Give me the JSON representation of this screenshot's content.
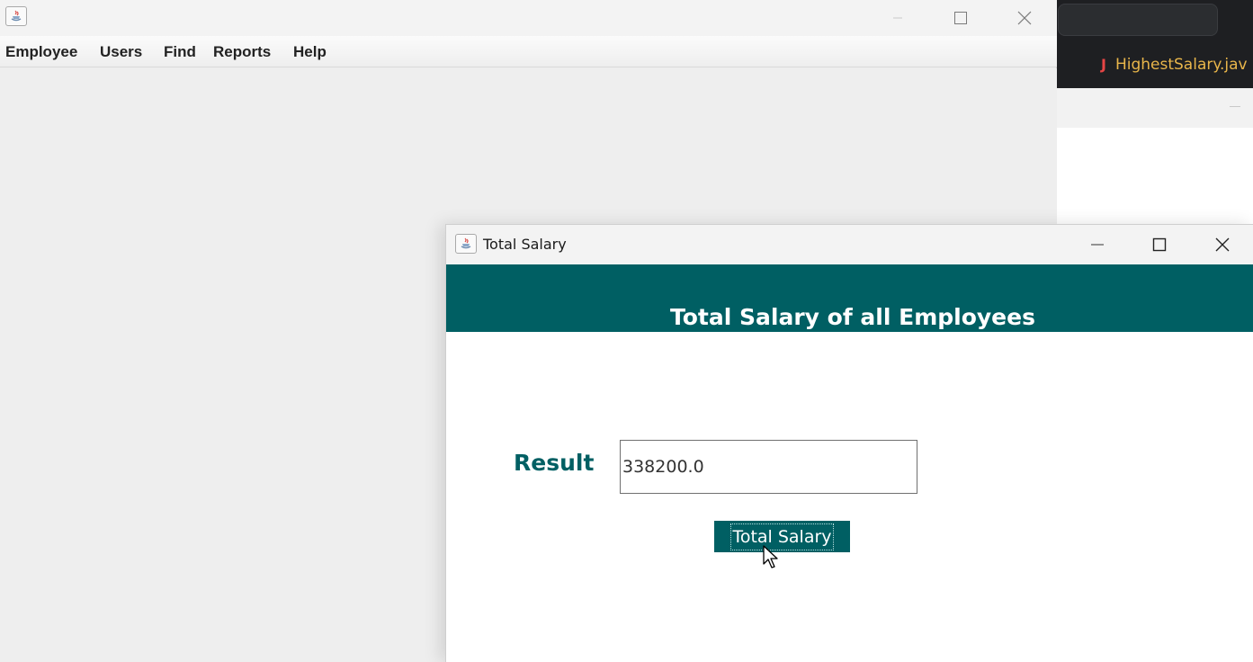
{
  "ide": {
    "tab_label": "HighestSalary.jav",
    "tab_icon": "java-file-icon"
  },
  "main_window": {
    "icon": "java-app-icon",
    "menu": [
      "Employee",
      "Users",
      "Find",
      "Reports",
      "Help"
    ]
  },
  "dialog": {
    "title": "Total Salary",
    "heading": "Total Salary of all Employees",
    "result_label": "Result",
    "result_value": "338200.0",
    "button_label": "Total Salary"
  },
  "colors": {
    "accent": "#005f63",
    "ide_tab_text": "#e8b54a",
    "java_icon": "#e64545"
  }
}
